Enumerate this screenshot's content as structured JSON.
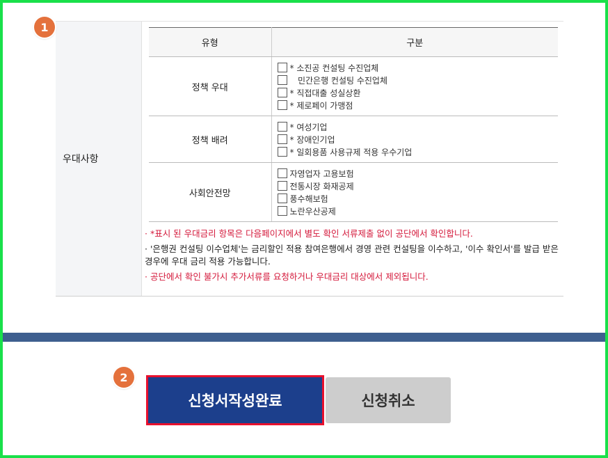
{
  "section": {
    "label": "우대사항",
    "table": {
      "headers": [
        "유형",
        "구분"
      ],
      "rows": [
        {
          "type": "정책 우대",
          "options": [
            "* 소진공 컨설팅 수진업체",
            "   민간은행 컨설팅 수진업체",
            "* 직접대출 성실상환",
            "* 제로페이 가맹점"
          ]
        },
        {
          "type": "정책 배려",
          "options": [
            "* 여성기업",
            "* 장애인기업",
            "* 일회용품 사용규제 적용 우수기업"
          ]
        },
        {
          "type": "사회안전망",
          "options": [
            "자영업자 고용보험",
            "전통시장 화재공제",
            "풍수해보험",
            "노란우산공제"
          ]
        }
      ]
    },
    "notes": [
      "· *표시 된 우대금리 항목은 다음페이지에서 별도 확인 서류제출 없이 공단에서 확인합니다.",
      "· '은행권 컨설팅 이수업체'는 금리할인 적용 참여은행에서 경영 관련 컨설팅을 이수하고, '이수 확인서'를 발급 받은 경우에 우대 금리 적용 가능합니다.",
      "· 공단에서 확인 불가시 추가서류를 요청하거나 우대금리 대상에서 제외됩니다."
    ]
  },
  "buttons": {
    "submit": "신청서작성완료",
    "cancel": "신청취소"
  },
  "badges": {
    "one": "1",
    "two": "2"
  },
  "colors": {
    "frame": "#19e04a",
    "badge": "#e4713c",
    "submit_bg": "#1c3f8c",
    "highlight": "#e8112e",
    "note_red": "#d4193b",
    "bar": "#3e5f8f"
  }
}
